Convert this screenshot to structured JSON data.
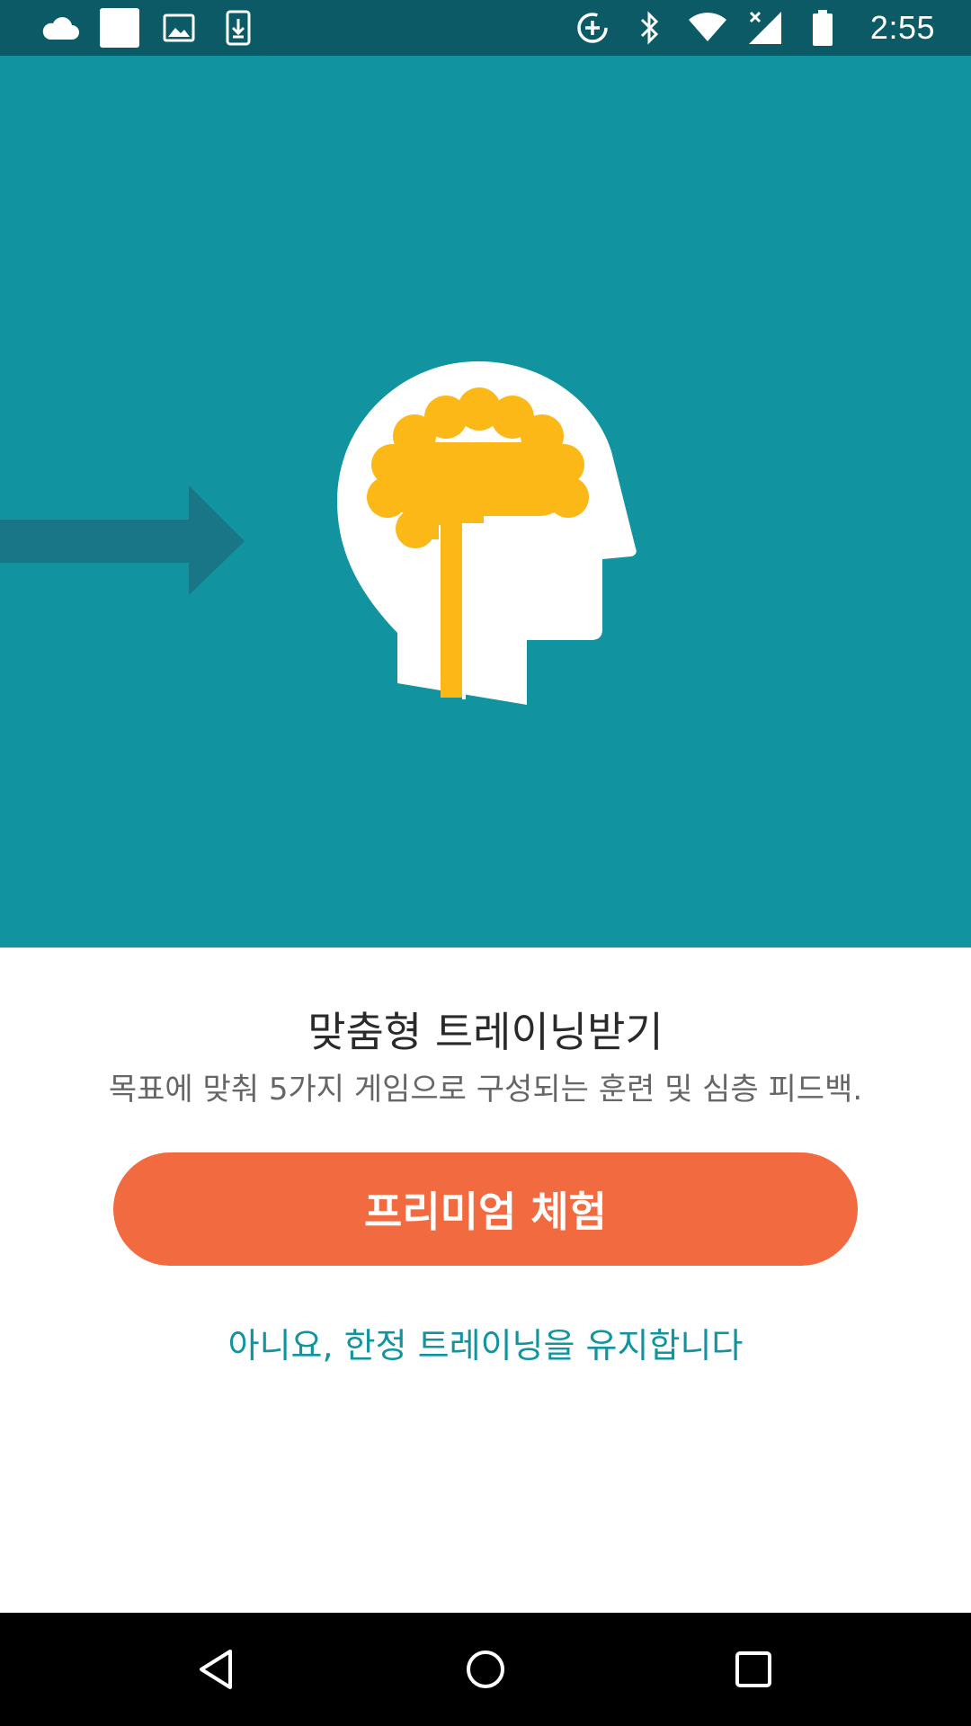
{
  "status_bar": {
    "left_icons": [
      "cloud-icon",
      "blank-notification-icon",
      "image-icon",
      "download-icon"
    ],
    "right_icons": [
      "data-saver-icon",
      "bluetooth-icon",
      "wifi-icon",
      "cell-signal-icon",
      "battery-icon"
    ],
    "time": "2:55",
    "background": "#0b5a66"
  },
  "hero": {
    "background": "#1193a0",
    "illustration": "head-brain-icon",
    "arrow": "arrow-right-icon",
    "brain_color": "#fbb817"
  },
  "promo": {
    "title": "맞춤형 트레이닝받기",
    "description": "목표에 맞춰 5가지 게임으로 구성되는 훈련 및 심층 피드백.",
    "cta_label": "프리미엄 체험",
    "cta_color": "#f26a40",
    "decline_label": "아니요, 한정 트레이닝을 유지합니다",
    "decline_color": "#1193a0"
  },
  "nav_bar": {
    "buttons": [
      "back-icon",
      "home-icon",
      "recents-icon"
    ]
  }
}
